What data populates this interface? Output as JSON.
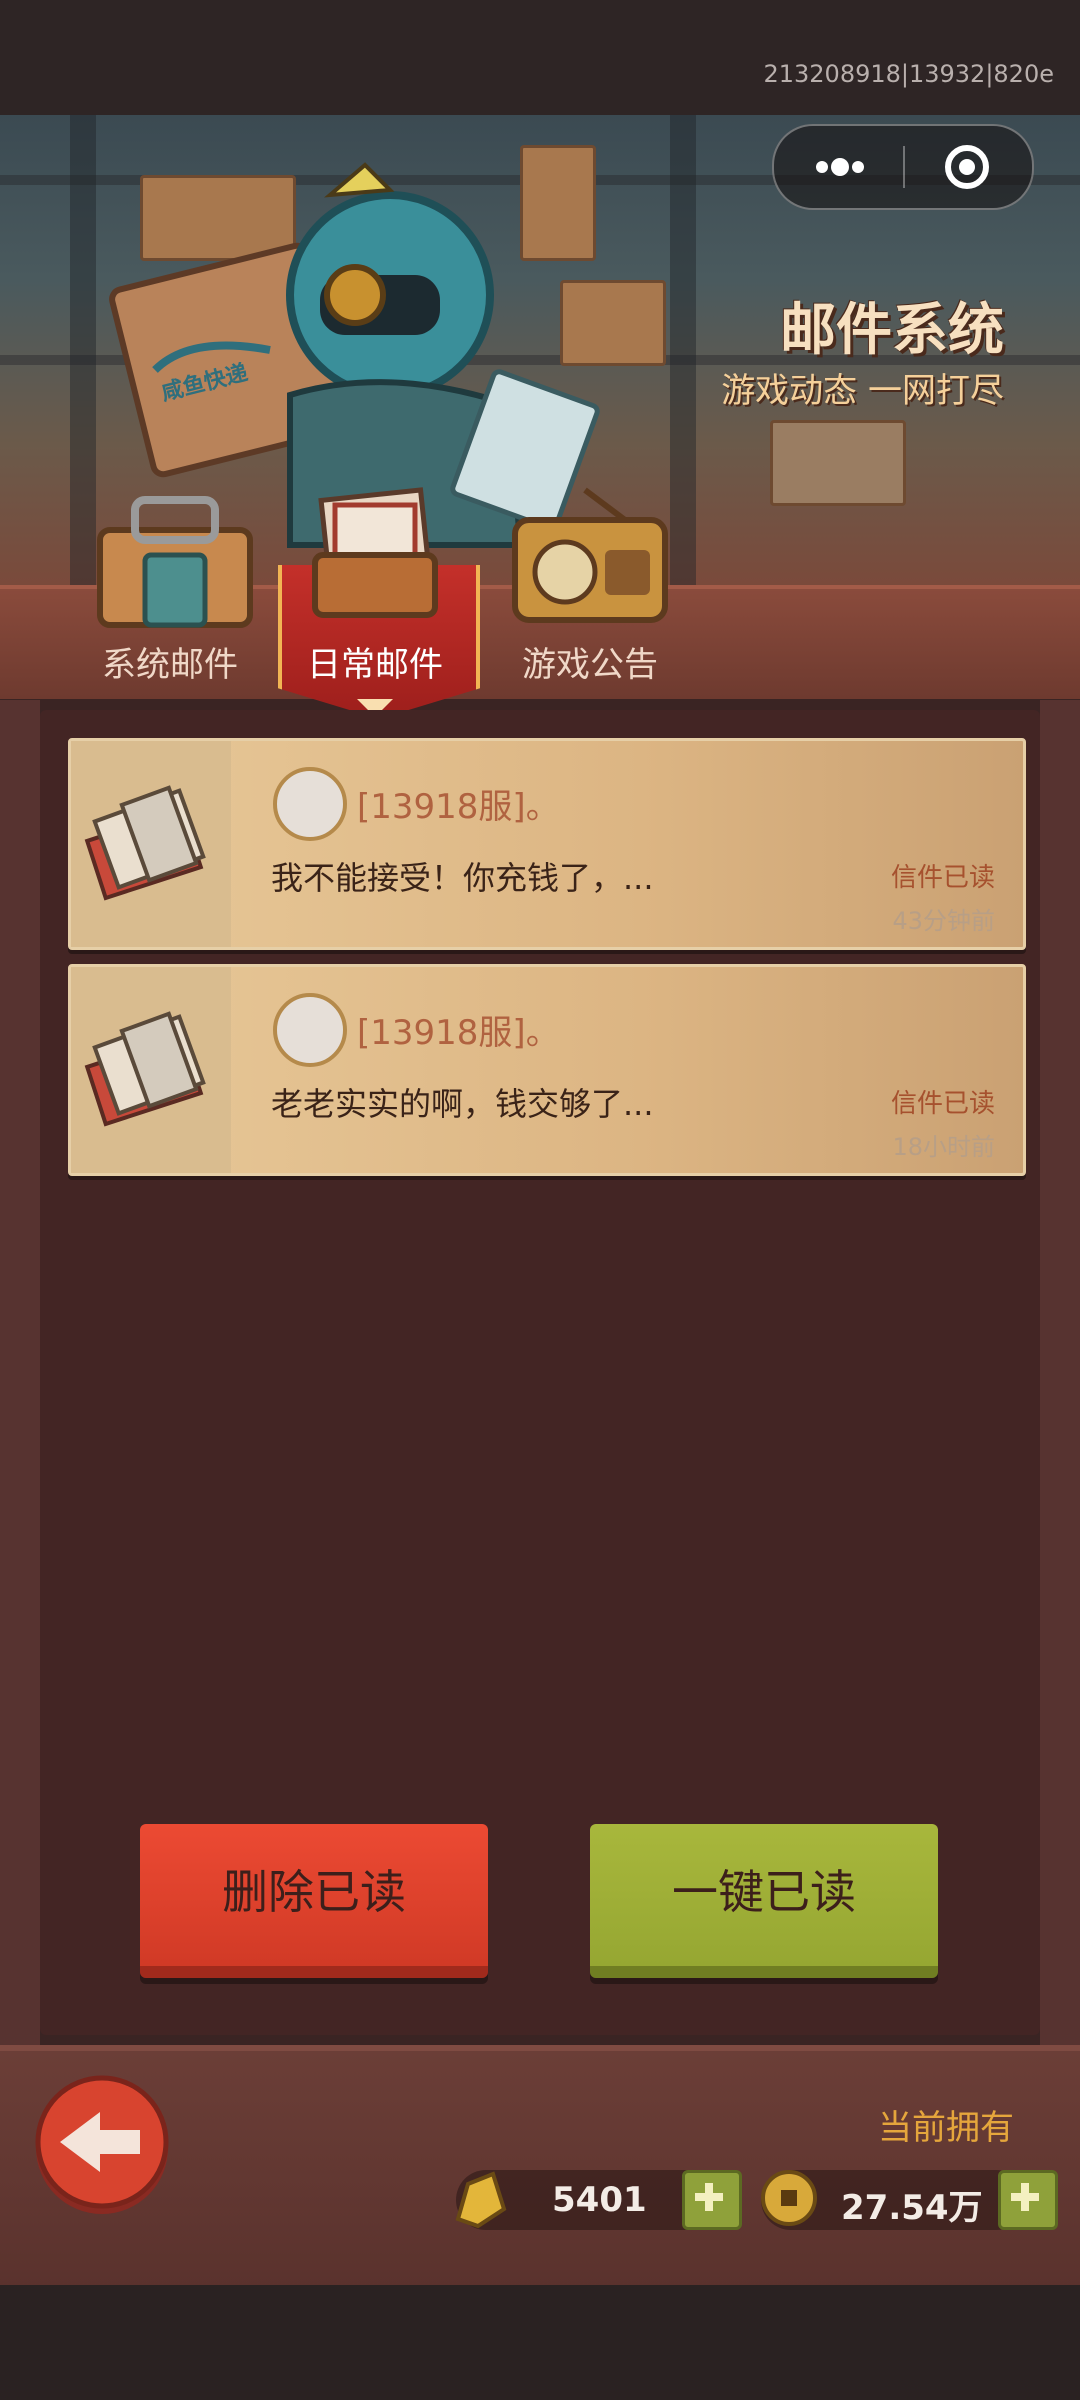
{
  "top": {
    "build_id": "213208918|13932|820e"
  },
  "banner": {
    "title": "邮件系统",
    "subtitle": "游戏动态 一网打尽",
    "box_label": "咸鱼快递"
  },
  "tabs": [
    {
      "label": "系统邮件",
      "active": false
    },
    {
      "label": "日常邮件",
      "active": true
    },
    {
      "label": "游戏公告",
      "active": false
    }
  ],
  "mails": [
    {
      "sender": "[13918服]。",
      "preview": "我不能接受！你充钱了，...",
      "status": "信件已读",
      "time": "43分钟前"
    },
    {
      "sender": "[13918服]。",
      "preview": "老老实实的啊，钱交够了...",
      "status": "信件已读",
      "time": "18小时前"
    }
  ],
  "buttons": {
    "delete_read": "删除已读",
    "mark_all_read": "一键已读"
  },
  "footer": {
    "owned_label": "当前拥有",
    "gold_ingot": "5401",
    "coins": "27.54万"
  },
  "colors": {
    "accent_red": "#d13a26",
    "accent_green": "#96a732",
    "gold": "#e5a63c"
  }
}
